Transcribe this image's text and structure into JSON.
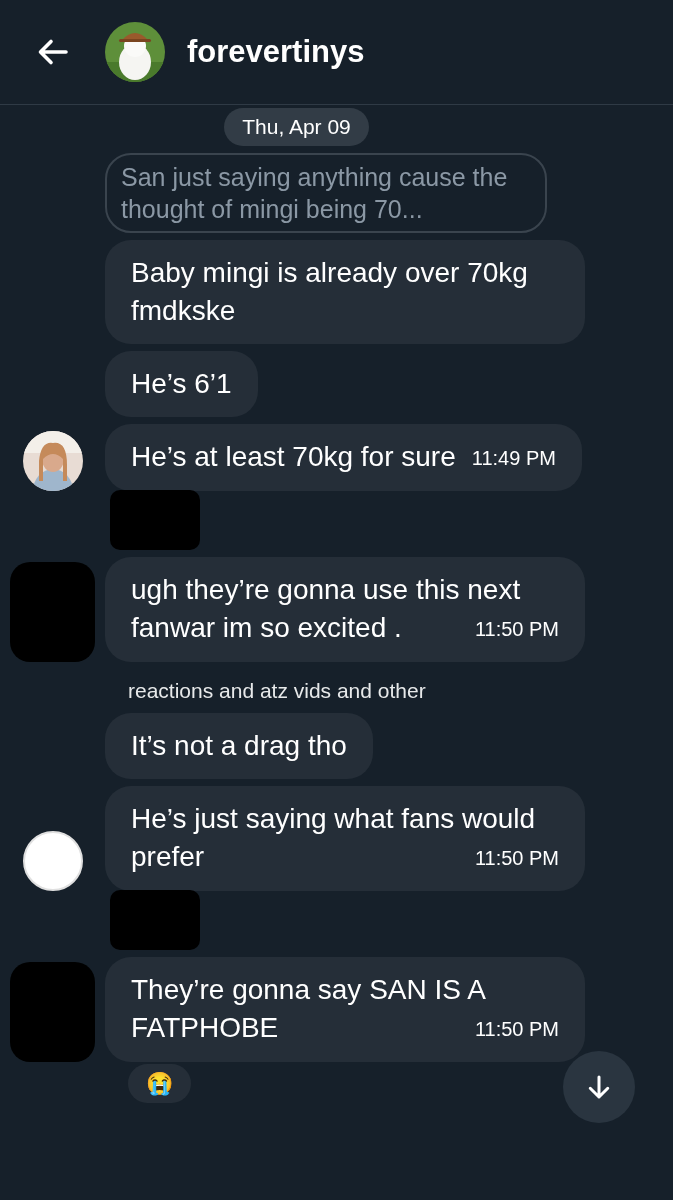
{
  "header": {
    "title": "forevertinys"
  },
  "date_divider": "Thu, Apr 09",
  "quoted_reply": "San just saying anything cause the thought of mingi being 70...",
  "messages": [
    {
      "kind": "message",
      "text": "Baby mingi is already over 70kg fmdkske"
    },
    {
      "kind": "message",
      "text": "He’s 6’1"
    },
    {
      "kind": "message",
      "text": "He’s at least 70kg for sure",
      "time": "11:49 PM"
    },
    {
      "kind": "redaction"
    },
    {
      "kind": "message",
      "text": "ugh they’re gonna use this next fanwar im so excited .",
      "time": "11:50 PM",
      "avatar": {
        "kind": "redacted"
      }
    },
    {
      "kind": "name",
      "text": "reactions and atz vids and other"
    },
    {
      "kind": "message",
      "text": "It’s not a drag tho"
    },
    {
      "kind": "message",
      "text": "He’s just saying what fans would prefer",
      "time": "11:50 PM",
      "avatar": {
        "kind": "plain"
      }
    },
    {
      "kind": "redaction"
    },
    {
      "kind": "message",
      "text": "They’re gonna say SAN IS A FATPHOBE",
      "time": "11:50 PM",
      "avatar": {
        "kind": "redacted"
      },
      "reaction": "😭"
    }
  ]
}
